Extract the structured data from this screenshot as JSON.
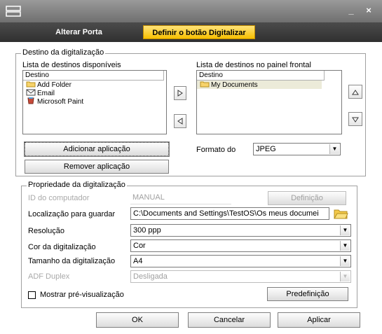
{
  "window": {
    "minimize": "_",
    "close": "×"
  },
  "tabs": [
    {
      "label": "Alterar Porta"
    },
    {
      "label": "Definir o botão Digitalizar"
    }
  ],
  "destination": {
    "legend": "Destino da digitalização",
    "available_label": "Lista de destinos disponíveis",
    "available_header": "Destino",
    "available_items": [
      "Add Folder",
      "Email",
      "Microsoft Paint"
    ],
    "front_label": "Lista de destinos no painel frontal",
    "front_header": "Destino",
    "front_items": [
      "My Documents"
    ],
    "add_button": "Adicionar aplicação",
    "remove_button": "Remover aplicação",
    "format_label": "Formato do",
    "format_value": "JPEG"
  },
  "properties": {
    "legend": "Propriedade da digitalização",
    "computer_id_label": "ID do computador",
    "computer_id_value": "MANUAL",
    "definition_button": "Definição",
    "save_location_label": "Localização para guardar",
    "save_location_value": "C:\\Documents and Settings\\TestOS\\Os meus documei",
    "resolution_label": "Resolução",
    "resolution_value": "300 ppp",
    "color_label": "Cor da digitalização",
    "color_value": "Cor",
    "size_label": "Tamanho da digitalização",
    "size_value": "A4",
    "duplex_label": "ADF Duplex",
    "duplex_value": "Desligada",
    "preview_label": "Mostrar pré-visualização",
    "preview_checked": false,
    "default_button": "Predefinição"
  },
  "footer": {
    "ok": "OK",
    "cancel": "Cancelar",
    "apply": "Aplicar"
  }
}
